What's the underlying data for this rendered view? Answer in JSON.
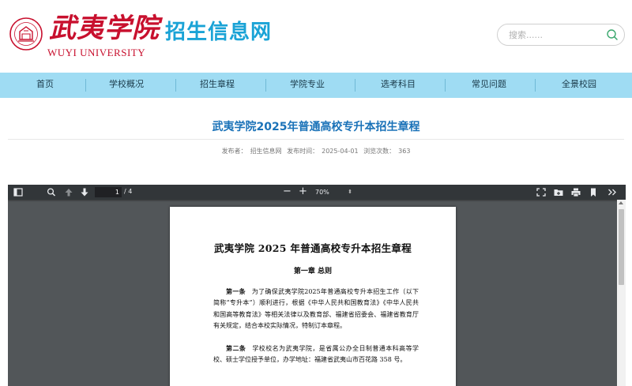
{
  "header": {
    "logo_cn": "武夷学院",
    "logo_en": "WUYI UNIVERSITY",
    "site_name": "招生信息网",
    "search_placeholder": "搜索......",
    "brand_color": "#c8102e",
    "accent_color": "#1aa3d6"
  },
  "nav": {
    "items": [
      {
        "label": "首页"
      },
      {
        "label": "学校概况"
      },
      {
        "label": "招生章程"
      },
      {
        "label": "学院专业"
      },
      {
        "label": "选考科目"
      },
      {
        "label": "常见问题"
      },
      {
        "label": "全景校园"
      }
    ],
    "bg_color": "#9fdcf3"
  },
  "article": {
    "title": "武夷学院2025年普通高校专升本招生章程",
    "publisher_label": "发布者：",
    "publisher": "招生信息网",
    "date_label": "发布时间：",
    "date": "2025-04-01",
    "views_label": "浏览次数：",
    "views": "363"
  },
  "pdf_viewer": {
    "current_page": "1",
    "total_pages": "/ 4",
    "zoom": "70%",
    "zoom_minus": "−",
    "zoom_plus": "+",
    "icons": [
      "sidebar-icon",
      "find-icon",
      "prev-page-icon",
      "next-page-icon",
      "presentation-icon",
      "open-file-icon",
      "print-icon",
      "bookmark-icon",
      "more-tools-icon"
    ],
    "document": {
      "title": "武夷学院 2025 年普通高校专升本招生章程",
      "chapter": "第一章 总则",
      "article1_head": "第一条",
      "article1_text": "为了确保武夷学院2025年普通高校专升本招生工作（以下简称“专升本”）顺利进行，根据《中华人民共和国教育法》《中华人民共和国高等教育法》等相关法律以及教育部、福建省招委会、福建省教育厅有关规定，结合本校实际情况，特制订本章程。",
      "article2_head": "第二条",
      "article2_text": "学校校名为武夷学院，是省属公办全日制普通本科高等学校、硕士学位授予单位，办学地址：福建省武夷山市百花路 358 号。"
    }
  }
}
